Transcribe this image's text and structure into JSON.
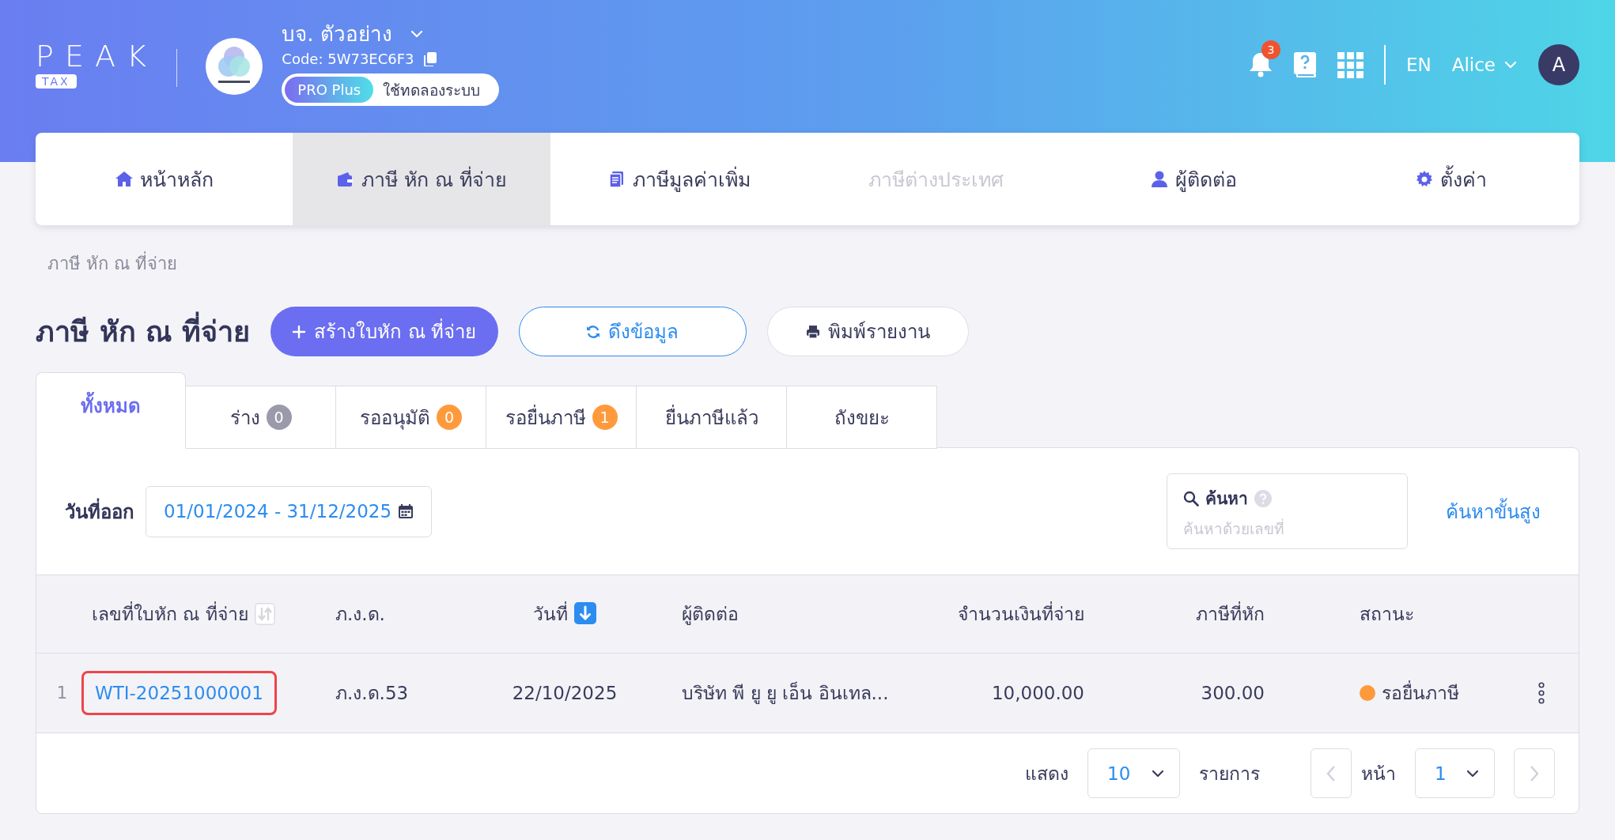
{
  "header": {
    "logo": {
      "wordmark": "PEAK",
      "badge": "TAX"
    },
    "company": {
      "name": "บจ. ตัวอย่าง",
      "code": "Code: 5W73EC6F3",
      "plan": "PRO Plus",
      "trial": "ใช้ทดลองระบบ"
    },
    "notification_count": "3",
    "language": "EN",
    "user": {
      "name": "Alice",
      "initial": "A"
    }
  },
  "nav": [
    {
      "label": "หน้าหลัก",
      "selected": false,
      "disabled": false
    },
    {
      "label": "ภาษี หัก ณ ที่จ่าย",
      "selected": true,
      "disabled": false
    },
    {
      "label": "ภาษีมูลค่าเพิ่ม",
      "selected": false,
      "disabled": false
    },
    {
      "label": "ภาษีต่างประเทศ",
      "selected": false,
      "disabled": true
    },
    {
      "label": "ผู้ติดต่อ",
      "selected": false,
      "disabled": false
    },
    {
      "label": "ตั้งค่า",
      "selected": false,
      "disabled": false
    }
  ],
  "breadcrumb": "ภาษี หัก ณ ที่จ่าย",
  "page_title": "ภาษี หัก ณ ที่จ่าย",
  "actions": [
    {
      "label": "สร้างใบหัก ณ ที่จ่าย",
      "kind": "primary"
    },
    {
      "label": "ดึงข้อมูล",
      "kind": "outline"
    },
    {
      "label": "พิมพ์รายงาน",
      "kind": "plain"
    }
  ],
  "tabs": [
    {
      "label": "ทั้งหมด",
      "selected": true
    },
    {
      "label": "ร่าง",
      "count": "0",
      "color": "#9a9aaa",
      "selected": false
    },
    {
      "label": "รออนุมัติ",
      "count": "0",
      "color": "#ff9a3c",
      "selected": false
    },
    {
      "label": "รอยื่นภาษี",
      "count": "1",
      "color": "#ff9a3c",
      "selected": false
    },
    {
      "label": "ยื่นภาษีแล้ว",
      "selected": false
    },
    {
      "label": "ถังขยะ",
      "selected": false
    }
  ],
  "filter": {
    "label": "วันที่ออก",
    "value": "01/01/2024 - 31/12/2025"
  },
  "search": {
    "label": "ค้นหา",
    "placeholder": "ค้นหาด้วยเลขที่"
  },
  "advanced_search": "ค้นหาขั้นสูง",
  "table": {
    "columns": [
      {
        "label": "เลขที่ใบหัก ณ ที่จ่าย",
        "sortable": true,
        "sorted": false
      },
      {
        "label": "ภ.ง.ด."
      },
      {
        "label": "วันที่",
        "sortable": true,
        "sorted": true
      },
      {
        "label": "ผู้ติดต่อ"
      },
      {
        "label": "จำนวนเงินที่จ่าย"
      },
      {
        "label": "ภาษีที่หัก"
      },
      {
        "label": "สถานะ"
      }
    ],
    "rows": [
      {
        "index": "1",
        "number": "WTI-20251000001",
        "highlighted": true,
        "form": "ภ.ง.ด.53",
        "date": "22/10/2025",
        "contact": "บริษัท พี ยู ยู เอ็น อินเทล...",
        "amount": "10,000.00",
        "tax": "300.00",
        "status": {
          "label": "รอยื่นภาษี",
          "color": "#ff9a3c"
        }
      }
    ]
  },
  "pagination": {
    "show_label": "แสดง",
    "page_size": "10",
    "items_label": "รายการ",
    "page_label": "หน้า",
    "page": "1"
  }
}
